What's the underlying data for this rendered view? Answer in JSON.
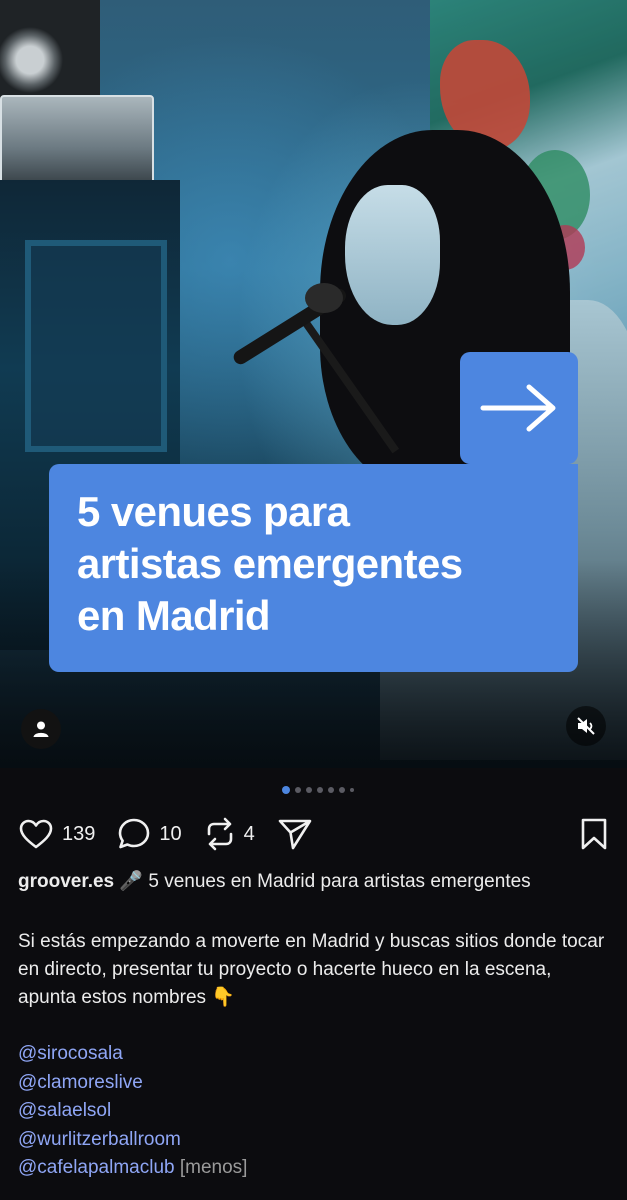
{
  "post": {
    "image_title": [
      "5 venues para",
      "artistas emergentes",
      "en Madrid"
    ],
    "likes": "139",
    "comments": "10",
    "reposts": "4",
    "author": "groover.es",
    "headline_emoji": "🎤",
    "headline": "5 venues en Madrid para artistas emergentes",
    "body": "Si estás empezando a moverte en Madrid y buscas sitios donde tocar en directo, presentar tu proyecto o hacerte hueco en la escena, apunta estos nombres",
    "body_emoji": "👇",
    "mentions": [
      "@sirocosala",
      "@clamoreslive",
      "@salaelsol",
      "@wurlitzerballroom",
      "@cafelapalmaclub"
    ],
    "less_label": "[menos]"
  },
  "carousel": {
    "total_dots": 7,
    "active_index": 0
  },
  "colors": {
    "accent": "#4d86e0",
    "mention": "#8fa6f5",
    "background": "#0c0c0f"
  },
  "icons": [
    "arrow-right-icon",
    "user-icon",
    "mute-icon",
    "heart-icon",
    "comment-icon",
    "repost-icon",
    "share-icon",
    "bookmark-icon"
  ]
}
